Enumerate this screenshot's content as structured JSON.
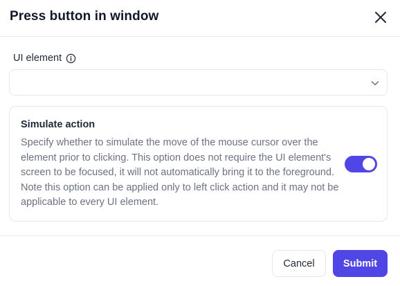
{
  "dialog": {
    "title": "Press button in window",
    "close_icon": "close-icon"
  },
  "ui_element": {
    "label": "UI element",
    "info_icon": "info-icon",
    "value": "",
    "dropdown_icon": "chevron-down-icon"
  },
  "simulate_action": {
    "title": "Simulate action",
    "description": "Specify whether to simulate the move of the mouse cursor over the element prior to clicking. This option does not require the UI element's screen to be focused, it will not automatically bring it to the foreground. Note this option can be applied only to left click action and it may not be applicable to every UI element.",
    "enabled": true
  },
  "footer": {
    "cancel_label": "Cancel",
    "submit_label": "Submit"
  },
  "colors": {
    "accent": "#5046e5",
    "border": "#e5e7eb",
    "muted_text": "#6b7280"
  }
}
